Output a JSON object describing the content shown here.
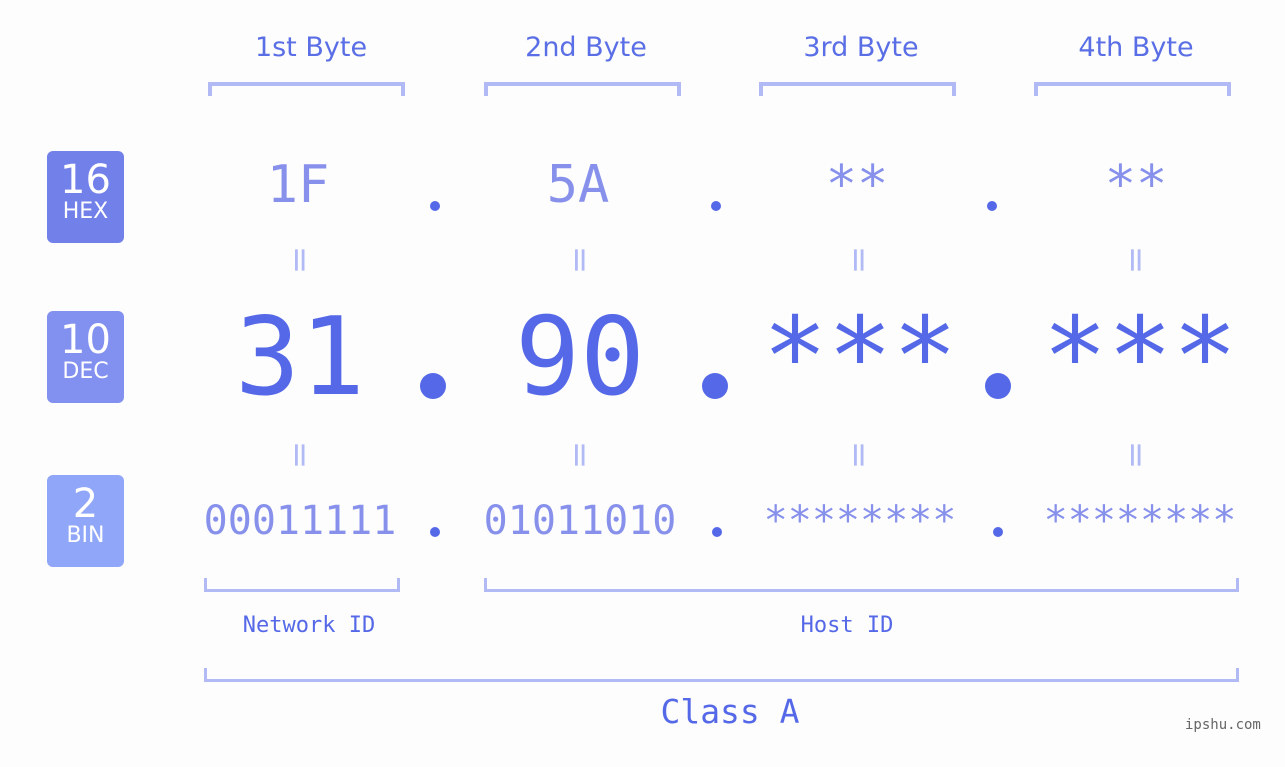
{
  "byte_headers": [
    "1st Byte",
    "2nd Byte",
    "3rd Byte",
    "4th Byte"
  ],
  "bases": [
    {
      "number": "16",
      "label": "HEX",
      "color": "#7280ea"
    },
    {
      "number": "10",
      "label": "DEC",
      "color": "#8290f0"
    },
    {
      "number": "2",
      "label": "BIN",
      "color": "#90a6f8"
    }
  ],
  "hex": [
    "1F",
    "5A",
    "**",
    "**"
  ],
  "dec": [
    "31",
    "90",
    "***",
    "***"
  ],
  "bin": [
    "00011111",
    "01011010",
    "********",
    "********"
  ],
  "equals_symbol": "=",
  "network_label": "Network ID",
  "host_label": "Host ID",
  "class_label": "Class A",
  "watermark": "ipshu.com"
}
